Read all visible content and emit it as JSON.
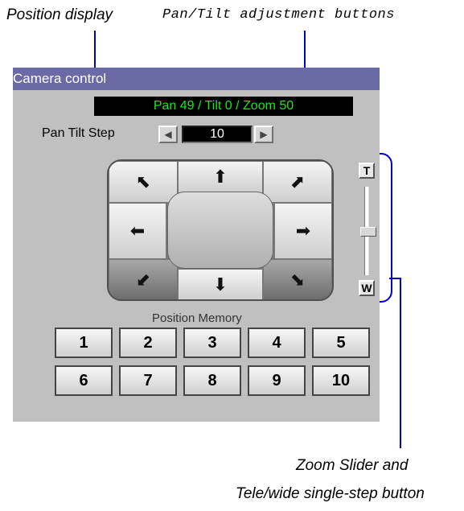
{
  "annotations": {
    "position_display": "Position display",
    "pan_tilt_buttons": "Pan/Tilt adjustment buttons",
    "zoom_line1": "Zoom Slider and",
    "zoom_line2": "Tele/wide single-step button"
  },
  "panel": {
    "title": "Camera control",
    "position_display": "Pan 49 / Tilt 0 / Zoom 50",
    "pan_tilt_step_label": "Pan Tilt Step",
    "pan_tilt_step_value": "10",
    "step_left_arrow": "◀",
    "step_right_arrow": "▶",
    "pad": {
      "up_left": "⬉",
      "up": "⬆",
      "up_right": "⬈",
      "left": "⬅",
      "right": "➡",
      "down_left": "⬋",
      "down": "⬇",
      "down_right": "⬊"
    },
    "zoom": {
      "tele": "T",
      "wide": "W",
      "level_fraction": 0.5
    },
    "position_memory_label": "Position Memory",
    "memory_buttons": [
      "1",
      "2",
      "3",
      "4",
      "5",
      "6",
      "7",
      "8",
      "9",
      "10"
    ]
  },
  "colors": {
    "callout": "#0000cc",
    "titlebar": "#6a6aa6",
    "display_text": "#19e619"
  }
}
